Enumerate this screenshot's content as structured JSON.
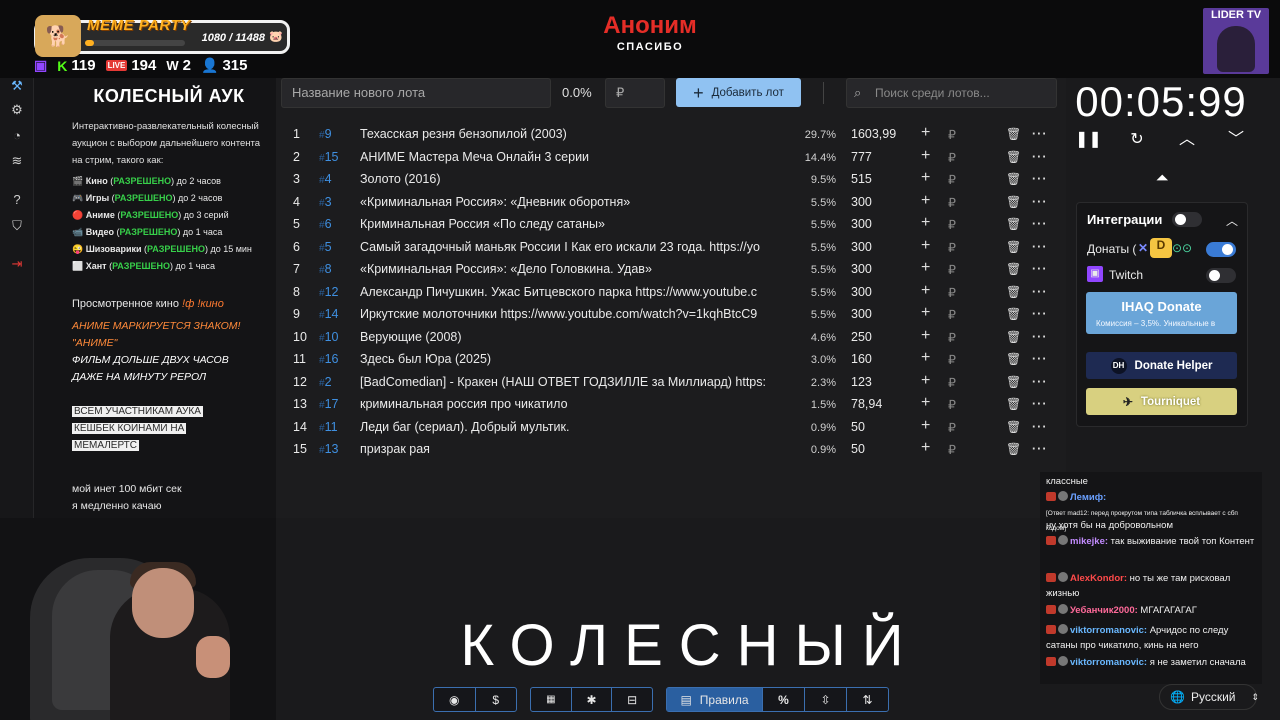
{
  "stream": {
    "meme_party": {
      "title": "MEME PARTY",
      "progress": "1080 / 11488",
      "fill_fraction": 0.094
    },
    "stats": [
      {
        "icon": "twitch-icon",
        "value": ""
      },
      {
        "icon": "kick-icon",
        "value": "119"
      },
      {
        "icon": "live-icon",
        "value": "194"
      },
      {
        "icon": "w-icon",
        "value": "2"
      },
      {
        "icon": "viewers-icon",
        "value": "315"
      }
    ],
    "donation": {
      "name": "Аноним",
      "thanks": "СПАСИБО"
    },
    "channel_badge": "LIDER TV"
  },
  "info": {
    "title": "КОЛЕСНЫЙ АУК",
    "description": "Интерактивно-развлекательный колесный аукцион с выбором дальнейшего контента на стрим, такого как:",
    "rules": [
      {
        "emoji": "🎬",
        "name": "Кино",
        "status": "РАЗРЕШЕНО",
        "limit": "до 2 часов"
      },
      {
        "emoji": "🎮",
        "name": "Игры",
        "status": "РАЗРЕШЕНО",
        "limit": "до 2 часов"
      },
      {
        "emoji": "🔴",
        "name": "Аниме",
        "status": "РАЗРЕШЕНО",
        "limit": "до 3 серий"
      },
      {
        "emoji": "📹",
        "name": "Видео",
        "status": "РАЗРЕШЕНО",
        "limit": "до 1 часа"
      },
      {
        "emoji": "😜",
        "name": "Шизоварики",
        "status": "РАЗРЕШЕНО",
        "limit": "до 15 мин"
      },
      {
        "emoji": "⬜",
        "name": "Хант",
        "status": "РАЗРЕШЕНО",
        "limit": "до 1 часа"
      }
    ],
    "watched_label": "Просмотренное кино",
    "watched_cmd": "!ф !кино",
    "anime_note": [
      "АНИМЕ МАРКИРУЕТСЯ ЗНАКОМ!",
      "\"АНИМЕ\"",
      "ФИЛЬМ ДОЛЬШЕ ДВУХ ЧАСОВ",
      "ДАЖЕ НА МИНУТУ РЕРОЛ"
    ],
    "cashback": [
      "ВСЕМ УЧАСТНИКАМ АУКА",
      "КЕШБЕК КОИНАМИ НА",
      "МЕМАЛЕРТС"
    ],
    "internet": [
      "мой инет 100 мбит сек",
      "я медленно качаю"
    ]
  },
  "toolbar": {
    "lot_placeholder": "Название нового лота",
    "percent": "0.0%",
    "currency_placeholder": "₽",
    "add_label": "Добавить лот",
    "search_placeholder": "Поиск среди лотов..."
  },
  "lots": [
    {
      "n": "1",
      "id": "9",
      "name": "Техасская резня бензопилой (2003)",
      "pct": "29.7%",
      "amount": "1603,99"
    },
    {
      "n": "2",
      "id": "15",
      "name": "АНИМЕ Мастера Меча Онлайн 3 серии",
      "pct": "14.4%",
      "amount": "777"
    },
    {
      "n": "3",
      "id": "4",
      "name": "Золото (2016)",
      "pct": "9.5%",
      "amount": "515"
    },
    {
      "n": "4",
      "id": "3",
      "name": "«Криминальная Россия»: «Дневник оборотня»",
      "pct": "5.5%",
      "amount": "300"
    },
    {
      "n": "5",
      "id": "6",
      "name": "Криминальная Россия «По следу сатаны»",
      "pct": "5.5%",
      "amount": "300"
    },
    {
      "n": "6",
      "id": "5",
      "name": "Самый загадочный маньяк России I Как его искали 23 года. https://yo",
      "pct": "5.5%",
      "amount": "300"
    },
    {
      "n": "7",
      "id": "8",
      "name": "«Криминальная Россия»: «Дело Головкина. Удав»",
      "pct": "5.5%",
      "amount": "300"
    },
    {
      "n": "8",
      "id": "12",
      "name": "Александр Пичушкин. Ужас Битцевского парка https://www.youtube.c",
      "pct": "5.5%",
      "amount": "300"
    },
    {
      "n": "9",
      "id": "14",
      "name": "Иркутские молоточники https://www.youtube.com/watch?v=1kqhBtcC9",
      "pct": "5.5%",
      "amount": "300"
    },
    {
      "n": "10",
      "id": "10",
      "name": "Верующие (2008)",
      "pct": "4.6%",
      "amount": "250"
    },
    {
      "n": "11",
      "id": "16",
      "name": "Здесь был Юра (2025)",
      "pct": "3.0%",
      "amount": "160"
    },
    {
      "n": "12",
      "id": "2",
      "name": "[BadComedian] - Кракен (НАШ ОТВЕТ ГОДЗИЛЛЕ за Миллиард) https:",
      "pct": "2.3%",
      "amount": "123"
    },
    {
      "n": "13",
      "id": "17",
      "name": "криминальная россия про чикатило",
      "pct": "1.5%",
      "amount": "78,94"
    },
    {
      "n": "14",
      "id": "11",
      "name": "Леди баг (сериал). Добрый мультик.",
      "pct": "0.9%",
      "amount": "50"
    },
    {
      "n": "15",
      "id": "13",
      "name": "призрак рая",
      "pct": "0.9%",
      "amount": "50"
    }
  ],
  "overlay_title": "КОЛЕСНЫЙ",
  "bottom_bar": {
    "rules_label": "Правила"
  },
  "timer": "00:05:99",
  "integrations": {
    "title": "Интеграции",
    "donations_label": "Донаты (",
    "twitch_label": "Twitch",
    "ihaq_title": "IHAQ Donate",
    "ihaq_sub": "Комиссия – 3,5%. Уникальные в",
    "donate_helper": "Donate Helper",
    "tourniquet": "Tourniquet"
  },
  "chat": [
    {
      "nick": "",
      "text": "классные"
    },
    {
      "nick": "Лемиф:",
      "text": "",
      "color": "#6aa0ff"
    },
    {
      "nick": "",
      "text": "[Ответ mad12: перед прокрутом типа табличка всплывает с сбп кодом]",
      "small": true
    },
    {
      "nick": "",
      "text": "ну хотя бы на добровольном"
    },
    {
      "nick": "mikejke:",
      "text": "так выживание твой топ Контент",
      "color": "#c38cff"
    },
    {
      "nick": "AlexKondor:",
      "text": "но ты же там рисковал жизнью",
      "color": "#ff4a4a"
    },
    {
      "nick": "Уебанчик2000:",
      "text": "МГАГАГАГАГ",
      "color": "#ff6a9a"
    },
    {
      "nick": "viktorromanovic:",
      "text": "Арчидос по следу сатаны про чикатило, кинь на него",
      "color": "#6ab8ff"
    },
    {
      "nick": "viktorromanovic:",
      "text": "я не заметил сначала",
      "color": "#6ab8ff"
    }
  ],
  "language": "Русский"
}
